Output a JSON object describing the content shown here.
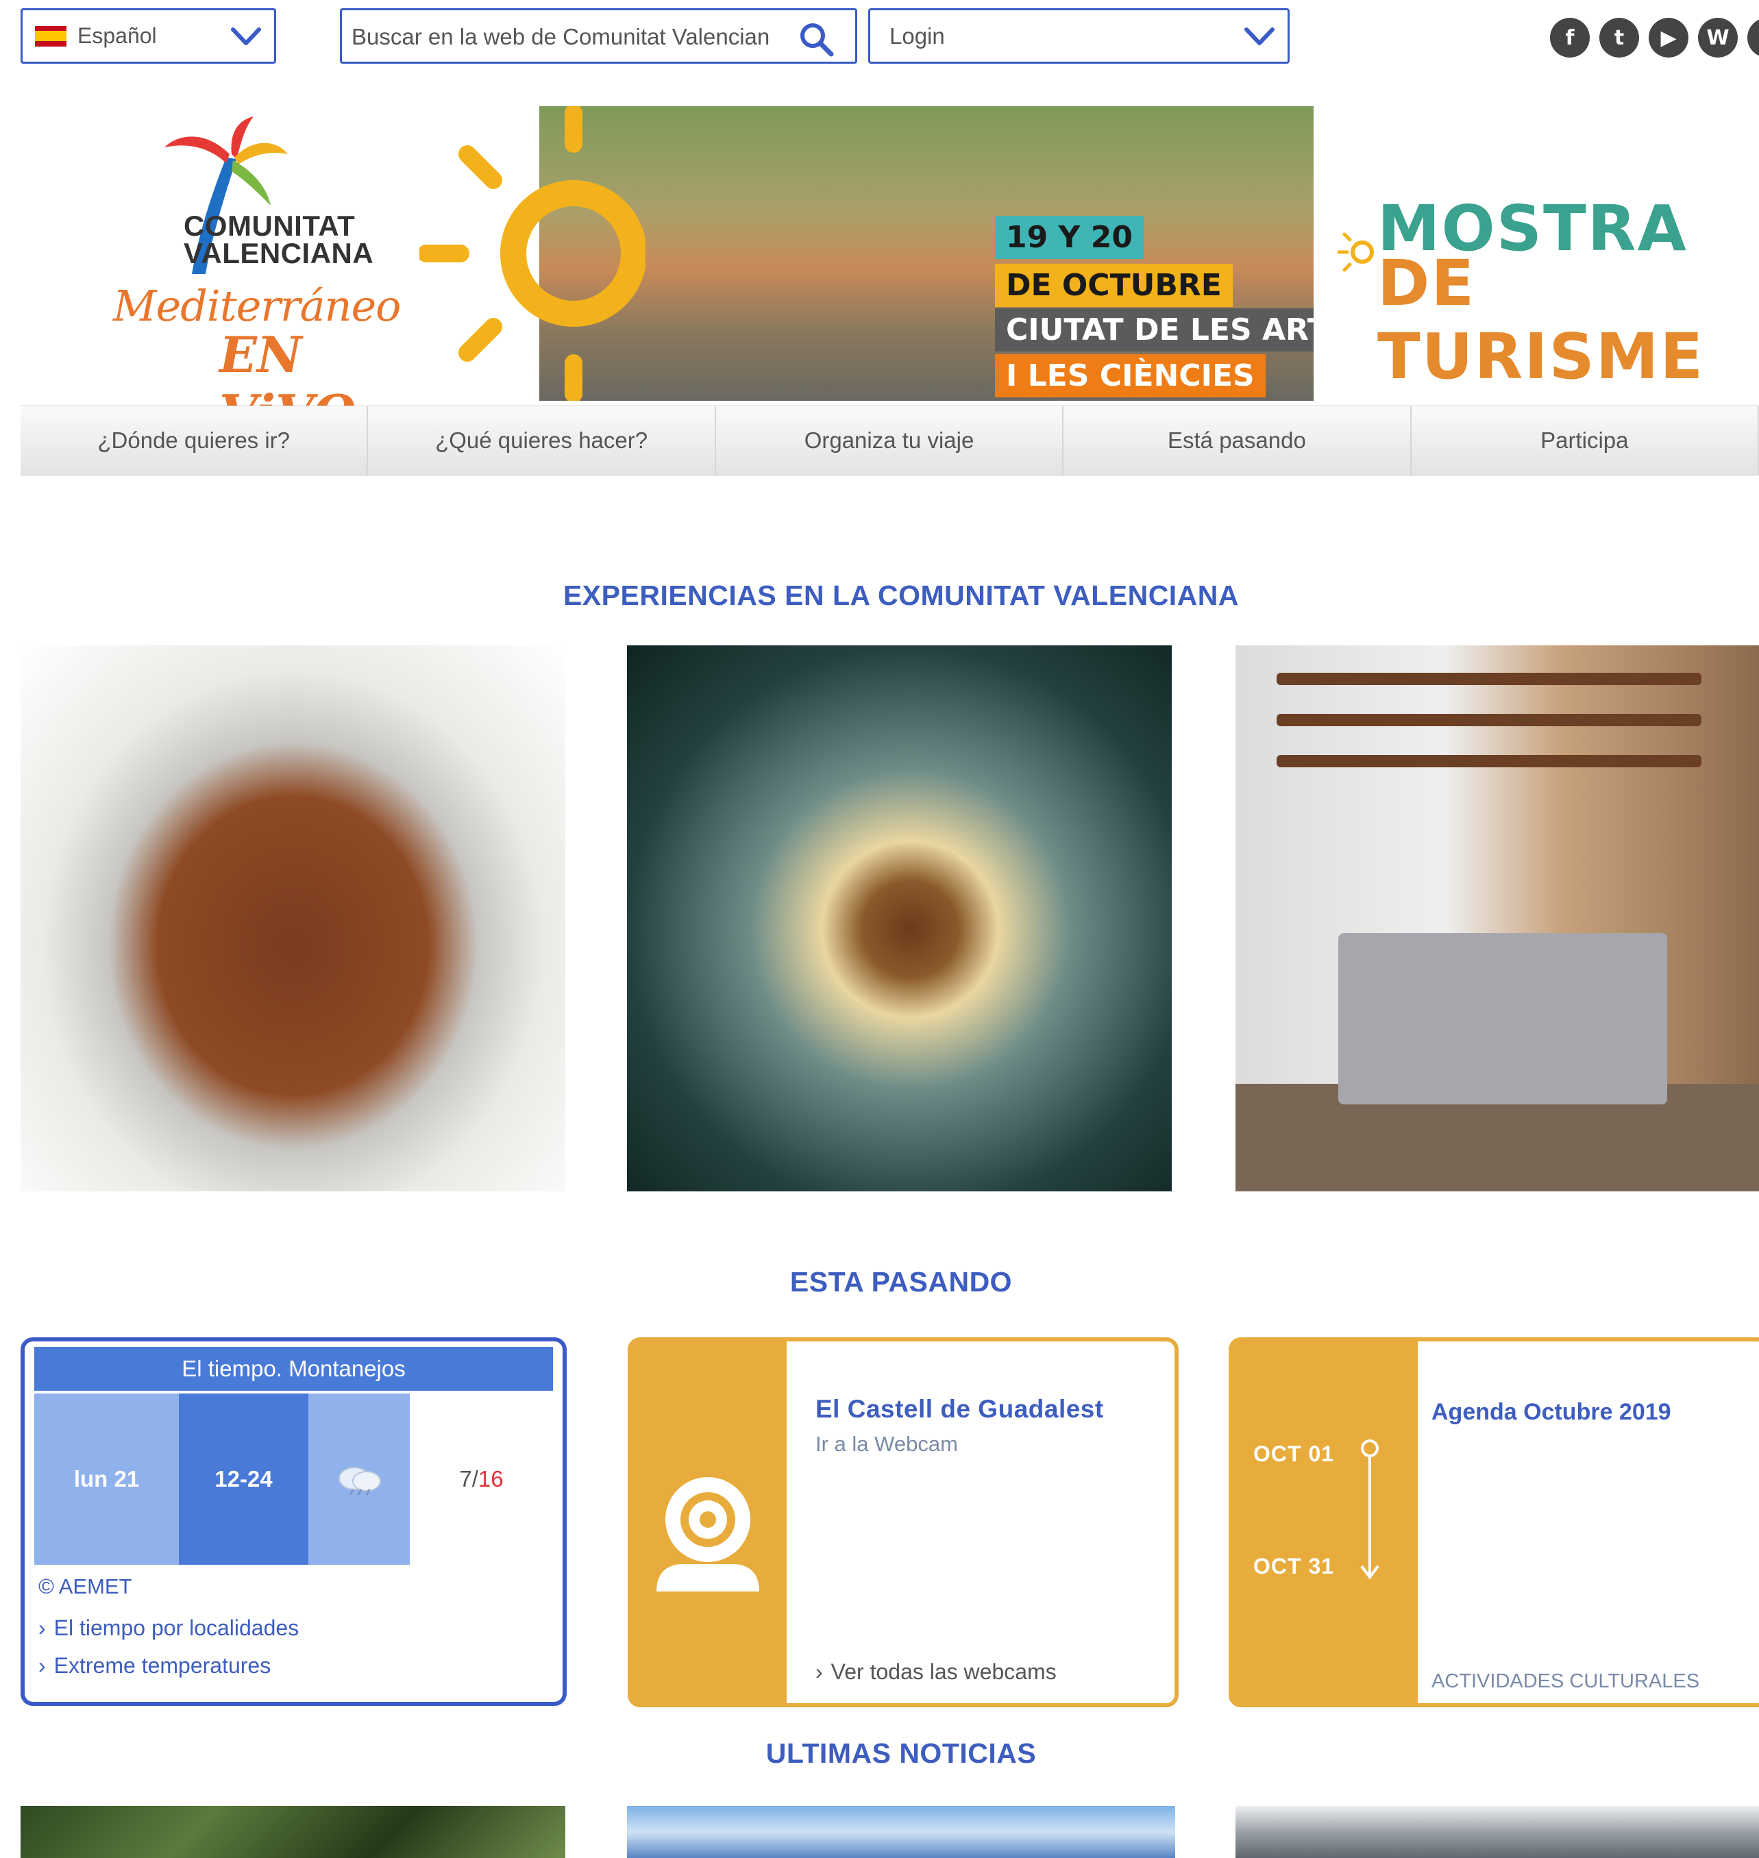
{
  "topbar": {
    "language": "Español",
    "search_placeholder": "Buscar en la web de Comunitat Valenciana",
    "login": "Login",
    "social": [
      "f",
      "t",
      "▶",
      "W",
      "i"
    ]
  },
  "logo": {
    "line1": "COMUNITAT",
    "line2": "VALENCIANA",
    "tagline1": "Mediterráneo",
    "tagline2": "EN ViVO"
  },
  "banner": {
    "tags": [
      "19 Y 20",
      "DE OCTUBRE",
      "CIUTAT DE LES ARTS",
      "I LES CIÈNCIES"
    ]
  },
  "mostra": {
    "line1": "MOSTRA",
    "line2": "DE TURISME"
  },
  "nav": [
    {
      "label": "¿Dónde quieres ir?"
    },
    {
      "label": "¿Qué quieres hacer?"
    },
    {
      "label": "Organiza tu viaje"
    },
    {
      "label": "Está pasando"
    },
    {
      "label": "Participa"
    }
  ],
  "sections": {
    "experiences": "EXPERIENCIAS EN LA COMUNITAT VALENCIANA",
    "happening": "ESTA PASANDO",
    "news": "ULTIMAS NOTICIAS"
  },
  "weather": {
    "title": "El tiempo. Montanejos",
    "day": "lun 21",
    "hours": "12-24",
    "temp_min": "7",
    "temp_sep": " / ",
    "temp_max": "16",
    "credit": "© AEMET",
    "links": [
      "El tiempo por localidades",
      "Extreme temperatures"
    ]
  },
  "webcam": {
    "title": "El Castell de Guadalest",
    "subtitle": "Ir a la Webcam",
    "all_link": "Ver todas las webcams"
  },
  "agenda": {
    "start": "OCT 01",
    "end": "OCT 31",
    "title": "Agenda Octubre 2019",
    "category": "ACTIVIDADES CULTURALES"
  },
  "colors": {
    "accent_blue": "#3d5dbf",
    "border_blue": "#3a5bc7",
    "amber": "#e8ac3c",
    "orange": "#e8762c"
  }
}
